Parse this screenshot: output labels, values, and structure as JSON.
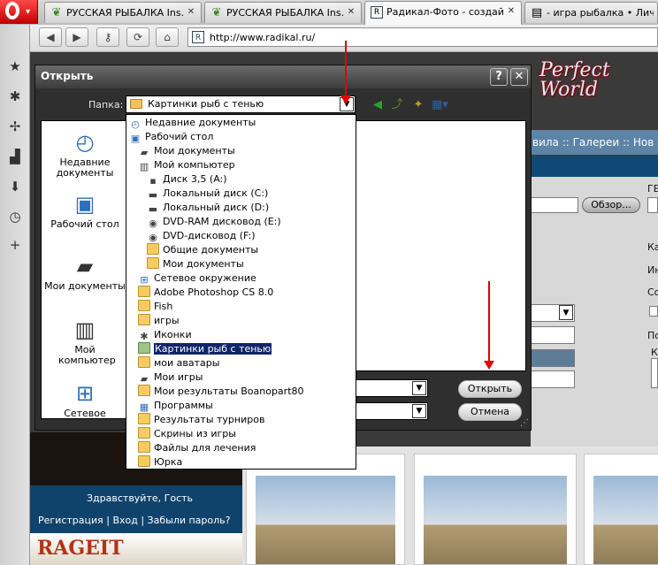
{
  "tabs": [
    {
      "title": "РУССКАЯ РЫБАЛКА Ins...",
      "icon": "butterfly-icon"
    },
    {
      "title": "РУССКАЯ РЫБАЛКА Ins...",
      "icon": "butterfly-icon"
    },
    {
      "title": "Радикал-Фото - создай...",
      "icon": "radikal-icon"
    },
    {
      "title": "- игра рыбалка • Личн...",
      "icon": "page-icon"
    }
  ],
  "address": {
    "url": "http://www.radikal.ru/"
  },
  "site": {
    "nav_text": "вила :: Галереи :: Нов",
    "browse_button": "Обзор...",
    "side_labels": [
      "ГЕ",
      "Ка",
      "Ин",
      "Со",
      "По",
      "К"
    ],
    "greeting": "Здравствуйте, Гость",
    "links": "Регистрация |  Вход |  Забыли пароль?",
    "logo_text": "Perfect World",
    "ad_text": "RAGEIT"
  },
  "dialog": {
    "title": "Открыть",
    "folder_label": "Папка:",
    "folder_value": "Картинки рыб с тенью",
    "help_button": "?",
    "close_button": "✕",
    "open_button": "Открыть",
    "cancel_button": "Отмена",
    "places": [
      {
        "label": "Недавние документы",
        "icon": "recent-documents-icon"
      },
      {
        "label": "Рабочий стол",
        "icon": "desktop-icon"
      },
      {
        "label": "Мои документы",
        "icon": "my-documents-icon"
      },
      {
        "label": "Мой компьютер",
        "icon": "my-computer-icon"
      },
      {
        "label": "Сетевое",
        "icon": "network-icon"
      }
    ]
  },
  "dropdown": {
    "items": [
      {
        "label": "Недавние документы",
        "indent": 0,
        "icon": "recent"
      },
      {
        "label": "Рабочий стол",
        "indent": 0,
        "icon": "desktop"
      },
      {
        "label": "Мои документы",
        "indent": 1,
        "icon": "docs"
      },
      {
        "label": "Мой компьютер",
        "indent": 1,
        "icon": "computer"
      },
      {
        "label": "Диск 3,5 (A:)",
        "indent": 2,
        "icon": "floppy"
      },
      {
        "label": "Локальный диск (C:)",
        "indent": 2,
        "icon": "drive"
      },
      {
        "label": "Локальный диск (D:)",
        "indent": 2,
        "icon": "drive"
      },
      {
        "label": "DVD-RAM дисковод (E:)",
        "indent": 2,
        "icon": "dvd"
      },
      {
        "label": "DVD-дисковод (F:)",
        "indent": 2,
        "icon": "dvd"
      },
      {
        "label": "Общие документы",
        "indent": 2,
        "icon": "folder"
      },
      {
        "label": "Мои документы",
        "indent": 2,
        "icon": "folder"
      },
      {
        "label": "Сетевое окружение",
        "indent": 1,
        "icon": "network"
      },
      {
        "label": "Adobe Photoshop CS 8.0",
        "indent": 1,
        "icon": "folder"
      },
      {
        "label": "Fish",
        "indent": 1,
        "icon": "folder"
      },
      {
        "label": "игры",
        "indent": 1,
        "icon": "folder"
      },
      {
        "label": "Иконки",
        "indent": 1,
        "icon": "gear"
      },
      {
        "label": "Картинки рыб с тенью",
        "indent": 1,
        "icon": "folder-green",
        "selected": true
      },
      {
        "label": "мои аватары",
        "indent": 1,
        "icon": "folder"
      },
      {
        "label": "Мои игры",
        "indent": 1,
        "icon": "games"
      },
      {
        "label": "Мои результаты Boanopart80",
        "indent": 1,
        "icon": "folder"
      },
      {
        "label": "Программы",
        "indent": 1,
        "icon": "programs"
      },
      {
        "label": "Результаты турниров",
        "indent": 1,
        "icon": "folder"
      },
      {
        "label": "Скрины из игры",
        "indent": 1,
        "icon": "folder"
      },
      {
        "label": "Файлы для лечения",
        "indent": 1,
        "icon": "folder"
      },
      {
        "label": "Юрка",
        "indent": 1,
        "icon": "folder"
      }
    ]
  }
}
